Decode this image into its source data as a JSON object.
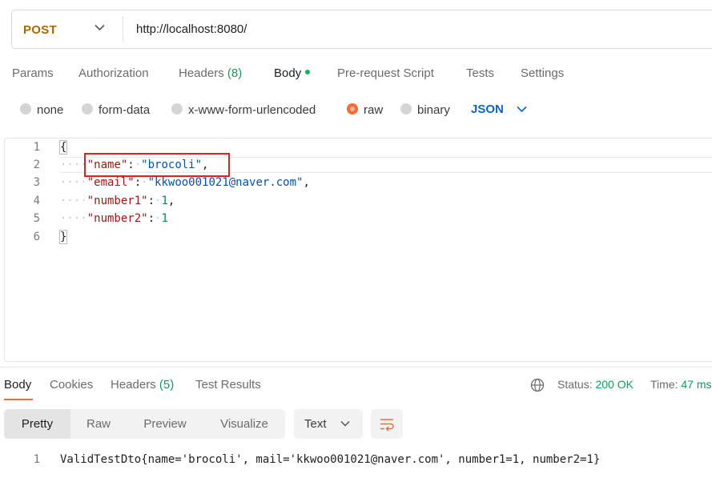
{
  "request": {
    "method": "POST",
    "url": "http://localhost:8080/"
  },
  "request_tabs": [
    {
      "label": "Params"
    },
    {
      "label": "Authorization"
    },
    {
      "label": "Headers",
      "count": "(8)"
    },
    {
      "label": "Body",
      "active": true
    },
    {
      "label": "Pre-request Script"
    },
    {
      "label": "Tests"
    },
    {
      "label": "Settings"
    }
  ],
  "body_types": [
    {
      "label": "none",
      "selected": false
    },
    {
      "label": "form-data",
      "selected": false
    },
    {
      "label": "x-www-form-urlencoded",
      "selected": false
    },
    {
      "label": "raw",
      "selected": true
    },
    {
      "label": "binary",
      "selected": false
    }
  ],
  "body_format": "JSON",
  "editor": {
    "line_numbers": [
      "1",
      "2",
      "3",
      "4",
      "5",
      "6"
    ],
    "lines": [
      "{",
      "    \"name\": \"brocoli\",",
      "    \"email\": \"kkwoo001021@naver.com\",",
      "    \"number1\": 1,",
      "    \"number2\": 1",
      "}"
    ],
    "tokens": {
      "open_brace": "{",
      "close_brace": "}",
      "key_name": "\"name\"",
      "val_name": "\"brocoli\"",
      "key_email": "\"email\"",
      "val_email": "\"kkwoo001021@naver.com\"",
      "key_number1": "\"number1\"",
      "val_number1": "1",
      "key_number2": "\"number2\"",
      "val_number2": "1",
      "indent": "····",
      "colon": ":",
      "comma": ",",
      "dot": "·"
    }
  },
  "response_tabs": [
    {
      "label": "Body",
      "active": true
    },
    {
      "label": "Cookies"
    },
    {
      "label": "Headers",
      "count": "(5)"
    },
    {
      "label": "Test Results"
    }
  ],
  "status": {
    "status_label": "Status:",
    "status_value": "200 OK",
    "time_label": "Time:",
    "time_value": "47 ms"
  },
  "view_modes": [
    "Pretty",
    "Raw",
    "Preview",
    "Visualize"
  ],
  "response_format": "Text",
  "response_body": {
    "line_number": "1",
    "text": "ValidTestDto{name='brocoli', mail='kkwoo001021@naver.com', number1=1, number2=1}"
  },
  "colors": {
    "accent": "#f26b3a",
    "method": "#a56a00",
    "link_blue": "#0e63c8",
    "status_green": "#0f9d58",
    "highlight_red": "#e32020"
  }
}
